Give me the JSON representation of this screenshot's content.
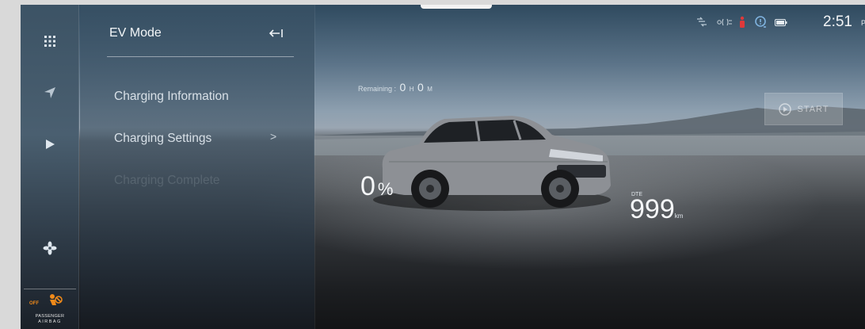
{
  "rail": {
    "items": [
      {
        "icon": "apps-grid-icon"
      },
      {
        "icon": "navigation-arrow-icon"
      },
      {
        "icon": "play-icon"
      },
      {
        "icon": "fan-icon"
      }
    ],
    "airbag": {
      "off_label": "OFF",
      "line1": "PASSENGER",
      "line2": "AIRBAG"
    }
  },
  "panel": {
    "title": "EV Mode",
    "collapse_icon": "collapse-left-icon",
    "items": [
      {
        "label": "Charging Information"
      },
      {
        "label": "Charging Settings",
        "chevron": ">"
      },
      {
        "label": "Charging Complete"
      }
    ]
  },
  "status": {
    "icons": [
      "network-icon",
      "headlight-icon",
      "seatbelt-warning-icon",
      "tpms-icon",
      "battery-icon"
    ],
    "time": "2:51",
    "time_suffix": "P"
  },
  "charging": {
    "remaining_label": "Remaining :",
    "hours": "0",
    "hours_unit": "H",
    "minutes": "0",
    "minutes_unit": "M",
    "start_label": "START",
    "soc_value": "0",
    "soc_unit": "%",
    "dte_label": "DTE",
    "dte_value": "999",
    "dte_unit": "km"
  },
  "colors": {
    "airbag_orange": "#f08a1a",
    "text_light": "#f3f6f8"
  }
}
